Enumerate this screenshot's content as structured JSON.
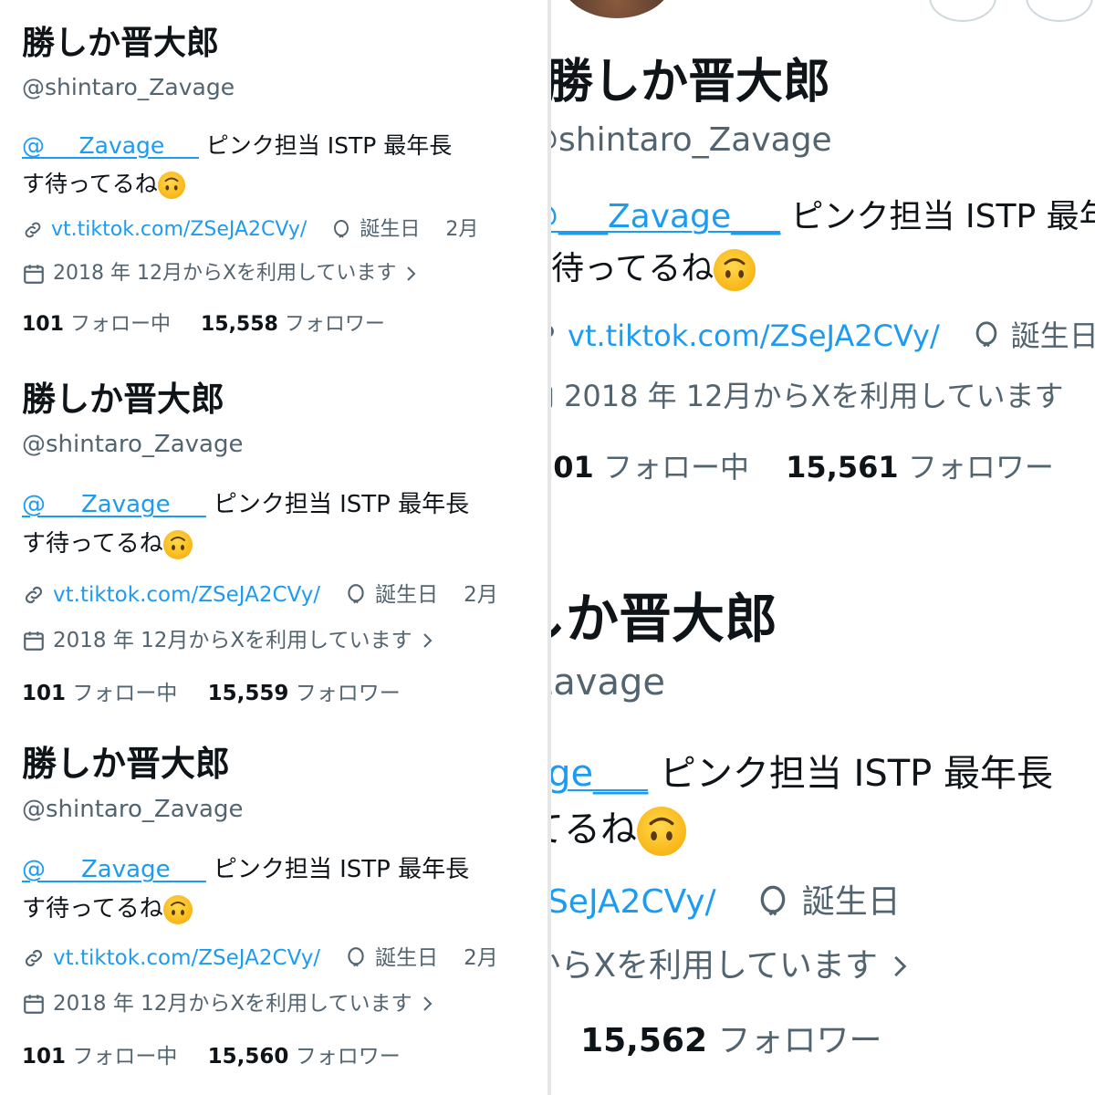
{
  "profile": {
    "name": "勝しか晋大郎",
    "handle": "@shintaro_Zavage",
    "mention": "@___Zavage___",
    "bio_rest": "ピンク担当 ISTP 最年長 ",
    "bio_line2": "す待ってるね",
    "emoji_icon": "upside-down-face-emoji",
    "link": "vt.tiktok.com/ZSeJA2CVy/",
    "birthday_label": "誕生日",
    "birthday_partial": "2月",
    "joined": "2018 年 12月からXを利用しています",
    "following_count": "101",
    "following_label": "フォロー中",
    "followers_label": "フォロワー"
  },
  "snapshots": [
    {
      "followers": "15,558"
    },
    {
      "followers": "15,559"
    },
    {
      "followers": "15,560"
    },
    {
      "followers": "15,561"
    },
    {
      "followers": "15,562"
    }
  ],
  "colors": {
    "accent": "#1d9bf0",
    "secondary": "#536471",
    "text": "#0f1419"
  }
}
